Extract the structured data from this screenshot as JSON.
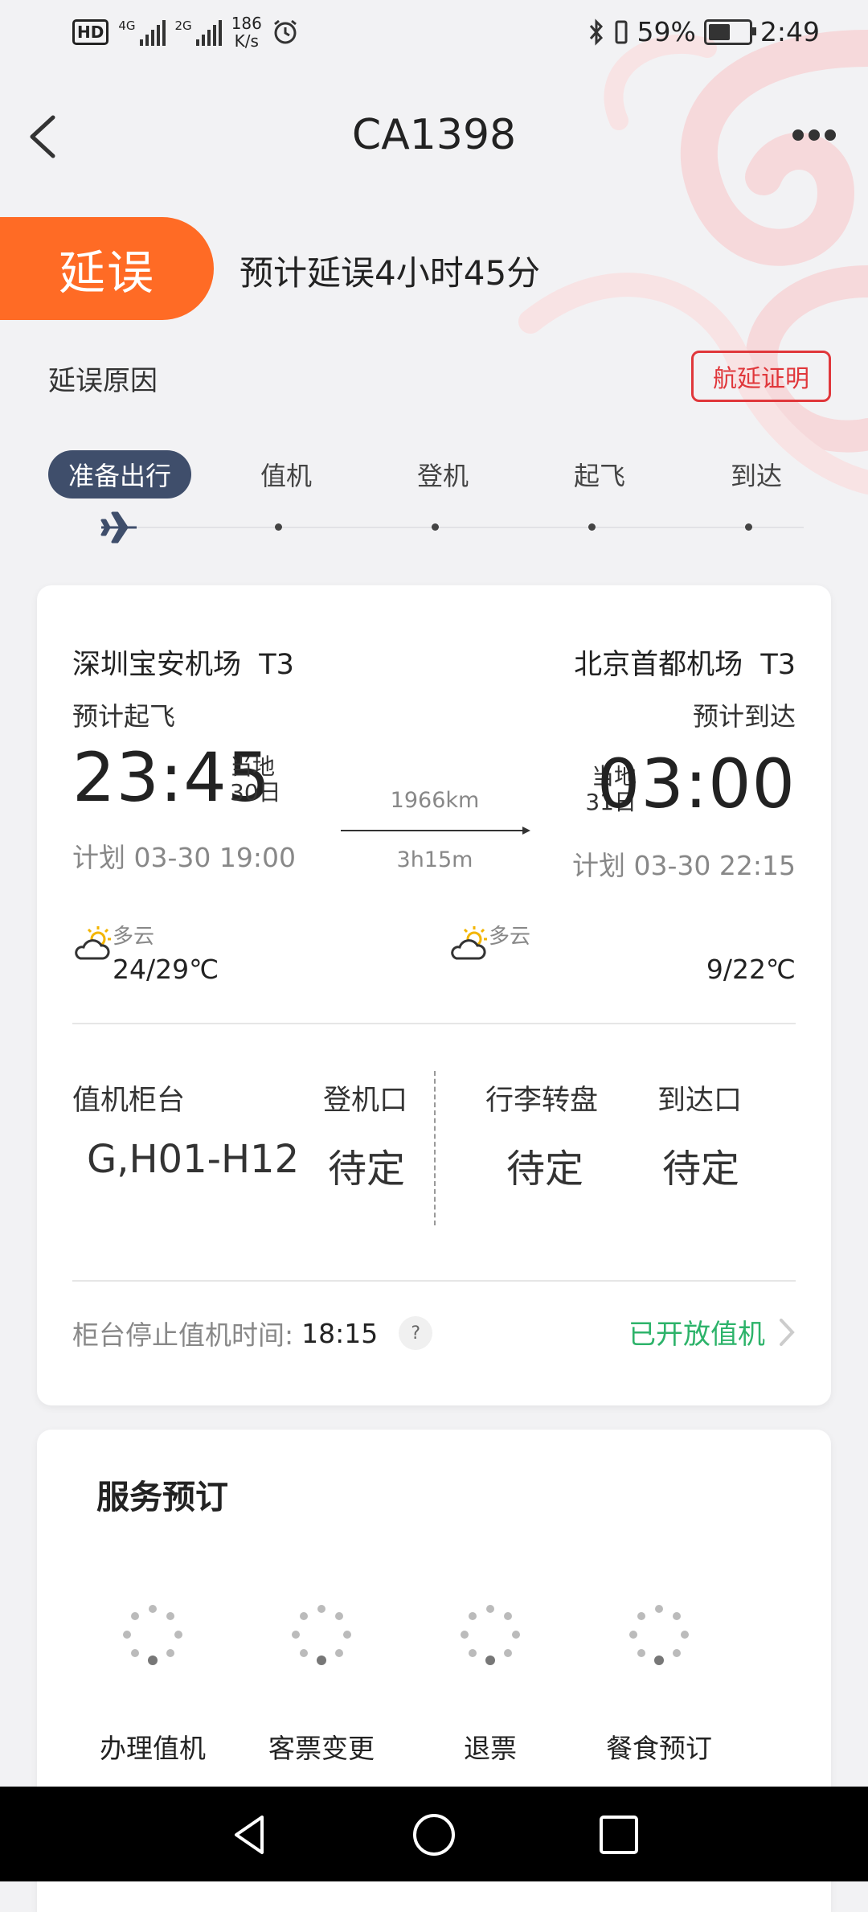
{
  "status_bar": {
    "hd": "HD",
    "signal1": "4G",
    "signal2": "2G",
    "speed_value": "186",
    "speed_unit": "K/s",
    "battery": "59%",
    "time": "2:49"
  },
  "header": {
    "title": "CA1398"
  },
  "delay": {
    "badge": "延误",
    "text": "预计延误4小时45分",
    "reason_label": "延误原因",
    "cert_button": "航延证明"
  },
  "progress": {
    "steps": [
      "准备出行",
      "值机",
      "登机",
      "起飞",
      "到达"
    ],
    "active_index": 0
  },
  "flight": {
    "departure": {
      "airport": "深圳宝安机场",
      "terminal": "T3",
      "label": "预计起飞",
      "time": "23:45",
      "local_label": "当地",
      "day": "30日",
      "planned": "计划 03-30 19:00",
      "weather": "多云",
      "temp": "24/29℃"
    },
    "arrival": {
      "airport": "北京首都机场",
      "terminal": "T3",
      "label": "预计到达",
      "time": "03:00",
      "local_label": "当地",
      "day": "31日",
      "planned": "计划 03-30 22:15",
      "weather": "多云",
      "temp": "9/22℃"
    },
    "distance": "1966km",
    "duration": "3h15m"
  },
  "info": {
    "checkin_counter_label": "值机柜台",
    "checkin_counter_value": "G,H01-H12",
    "gate_label": "登机口",
    "gate_value": "待定",
    "baggage_label": "行李转盘",
    "baggage_value": "待定",
    "exit_label": "到达口",
    "exit_value": "待定"
  },
  "checkin": {
    "stop_label": "柜台停止值机时间:",
    "stop_time": "18:15",
    "help": "?",
    "status": "已开放值机"
  },
  "services": {
    "title": "服务预订",
    "items": [
      "办理值机",
      "客票变更",
      "退票",
      "餐食预订"
    ]
  },
  "colors": {
    "delay_orange": "#ff6b25",
    "cert_red": "#e0373b",
    "active_step": "#3f4e6b",
    "open_green": "#2db36a"
  }
}
